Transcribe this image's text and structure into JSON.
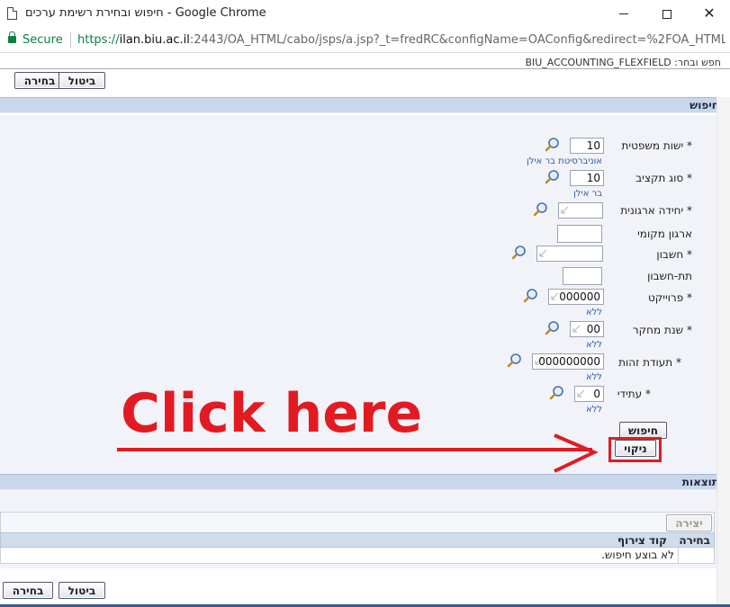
{
  "window": {
    "title": "חיפוש ובחירת רשימת ערכים - Google Chrome",
    "minimize_icon": "minimize-icon",
    "maximize_icon": "maximize-icon",
    "close_icon": "close-icon"
  },
  "address": {
    "secure_label": "Secure",
    "url_scheme": "https://",
    "url_host": "ilan.biu.ac.il",
    "url_rest": ":2443/OA_HTML/cabo/jsps/a.jsp?_t=fredRC&configName=OAConfig&redirect=%2FOA_HTML%..."
  },
  "header": {
    "breadcrumb": "חפש ובחר: BIU_ACCOUNTING_FLEXFIELD",
    "select_button": "בחירה",
    "cancel_button": "ביטול"
  },
  "search": {
    "section_title": "חיפוש",
    "fields": [
      {
        "label": "* ישות משפטית",
        "value": "10",
        "description": "אוניברסיטת בר אילן"
      },
      {
        "label": "* סוג תקציב",
        "value": "10",
        "description": "בר אילן"
      },
      {
        "label": "* יחידה ארגונית",
        "value": "",
        "description": ""
      },
      {
        "label": "ארגון מקומי",
        "value": "",
        "description": ""
      },
      {
        "label": "* חשבון",
        "value": "",
        "description": ""
      },
      {
        "label": "תת-חשבון",
        "value": "",
        "description": ""
      },
      {
        "label": "* פרוייקט",
        "value": "000000",
        "description": "ללא"
      },
      {
        "label": "* שנת מחקר",
        "value": "00",
        "description": "ללא"
      },
      {
        "label": "* תעודת זהות",
        "value": "000000000",
        "description": "ללא"
      },
      {
        "label": "* עתידי",
        "value": "0",
        "description": "ללא"
      }
    ],
    "go_button": "חיפוש",
    "clear_button": "ניקוי"
  },
  "annotation": {
    "text": "Click here",
    "color": "#e21b23"
  },
  "results": {
    "section_title": "תוצאות",
    "create_button": "יצירה",
    "columns": [
      "בחירה",
      "קוד צירוף"
    ],
    "empty_message": "לא בוצע חיפוש."
  },
  "footer": {
    "select_button": "בחירה",
    "cancel_button": "ביטול"
  },
  "colors": {
    "section_header": "#c9d7ea",
    "region_bg": "#f1f3f8",
    "link_blue": "#2f5a9c",
    "secure_green": "#0b8043"
  }
}
